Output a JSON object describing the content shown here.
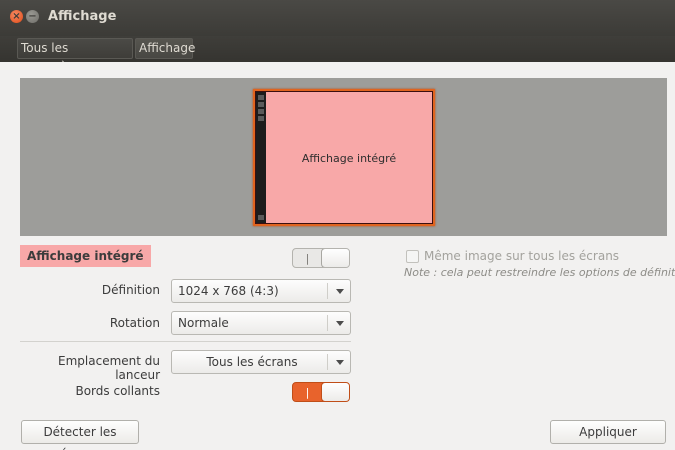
{
  "window": {
    "title": "Affichage",
    "close_glyph": "×",
    "minimize_glyph": "−"
  },
  "breadcrumb": {
    "items": [
      {
        "label": "Tous les paramètres"
      },
      {
        "label": "Affichage"
      }
    ]
  },
  "preview": {
    "monitor_label": "Affichage intégré",
    "monitor_fill": "#f8a8a8",
    "selection_border": "#e0641f"
  },
  "display": {
    "name": "Affichage intégré",
    "enabled": true,
    "switch_glyph": "|"
  },
  "settings": {
    "definition_label": "Définition",
    "definition_value": "1024 x 768 (4:3)",
    "rotation_label": "Rotation",
    "rotation_value": "Normale",
    "launcher_label": "Emplacement du lanceur",
    "launcher_value": "Tous les écrans",
    "sticky_label": "Bords collants",
    "sticky_enabled": true
  },
  "mirror": {
    "label": "Même image sur tous les écrans",
    "checked": false,
    "enabled": false,
    "note": "Note : cela peut restreindre les options de définition"
  },
  "buttons": {
    "detect": "Détecter les écrans",
    "apply": "Appliquer"
  },
  "colors": {
    "accent": "#e8632c",
    "titlebar": "#3c3b37",
    "background": "#f2f1f0"
  }
}
